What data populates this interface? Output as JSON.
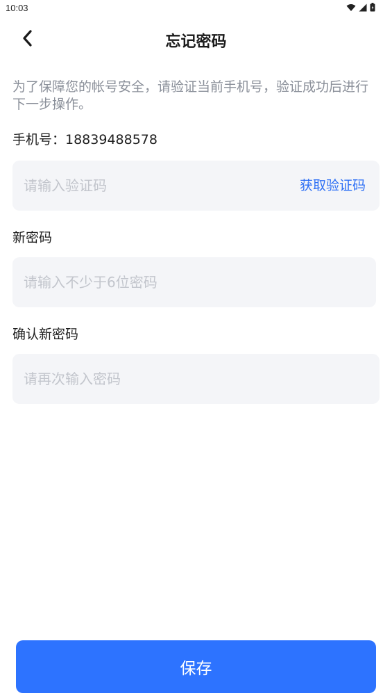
{
  "status_bar": {
    "time": "10:03",
    "icons": [
      "wifi-icon",
      "signal-icon",
      "battery-icon"
    ]
  },
  "header": {
    "back_icon": "chevron-left-icon",
    "title": "忘记密码"
  },
  "intro": {
    "hint": "为了保障您的帐号安全，请验证当前手机号，验证成功后进行下一步操作。",
    "phone_label": "手机号：18839488578"
  },
  "form": {
    "code_placeholder": "请输入验证码",
    "get_code_label": "获取验证码",
    "new_password_label": "新密码",
    "new_password_placeholder": "请输入不少于6位密码",
    "confirm_password_label": "确认新密码",
    "confirm_password_placeholder": "请再次输入密码"
  },
  "actions": {
    "save_label": "保存"
  },
  "colors": {
    "accent": "#2d73ff",
    "link": "#2d6ff5",
    "field_bg": "#f4f5f8",
    "hint_text": "#8a8f99",
    "placeholder": "#c2c5cc"
  }
}
